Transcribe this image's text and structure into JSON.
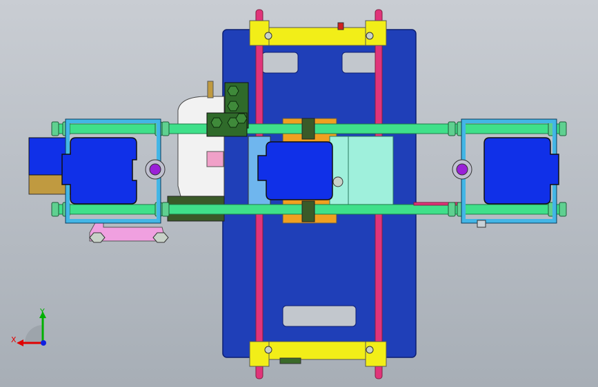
{
  "viewport": {
    "background_top": "#c9cdd3",
    "background_bottom": "#a7aeb6"
  },
  "triad": {
    "x_label": "X",
    "y_label": "Y",
    "x_color": "#e00000",
    "y_color": "#00b000",
    "z_color": "#1020e0"
  },
  "colors": {
    "plate": "#1f3fb8",
    "plate_edge": "#0c1e70",
    "yellow": "#f2ee18",
    "pink_rod": "#e0347a",
    "green_rod": "#3fe08a",
    "block_blue": "#1030e8",
    "frame_cyan": "#43b6e6",
    "bearing_purple": "#9a20d8",
    "nut_grey": "#c8d2c8",
    "olive": "#3a5a28",
    "mint": "#9ff0dc",
    "orange": "#f0a020",
    "white_part": "#f2f2f2",
    "tan": "#c09a40",
    "pink_bracket": "#f0a0e0"
  }
}
